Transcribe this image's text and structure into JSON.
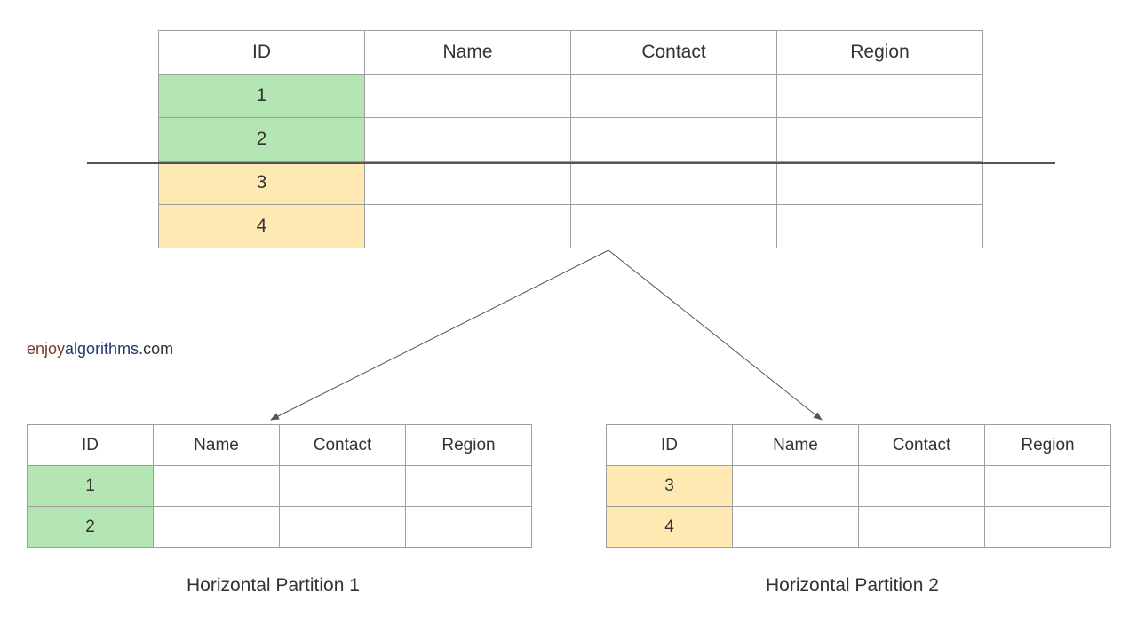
{
  "watermark": {
    "part1": "enjoy",
    "part2": "algorithms",
    "part3": ".com"
  },
  "main_table": {
    "headers": [
      "ID",
      "Name",
      "Contact",
      "Region"
    ],
    "rows": [
      {
        "id": "1",
        "color": "green"
      },
      {
        "id": "2",
        "color": "green"
      },
      {
        "id": "3",
        "color": "yellow"
      },
      {
        "id": "4",
        "color": "yellow"
      }
    ]
  },
  "partitions": [
    {
      "caption": "Horizontal Partition 1",
      "headers": [
        "ID",
        "Name",
        "Contact",
        "Region"
      ],
      "rows": [
        {
          "id": "1",
          "color": "green"
        },
        {
          "id": "2",
          "color": "green"
        }
      ]
    },
    {
      "caption": "Horizontal Partition 2",
      "headers": [
        "ID",
        "Name",
        "Contact",
        "Region"
      ],
      "rows": [
        {
          "id": "3",
          "color": "yellow"
        },
        {
          "id": "4",
          "color": "yellow"
        }
      ]
    }
  ]
}
